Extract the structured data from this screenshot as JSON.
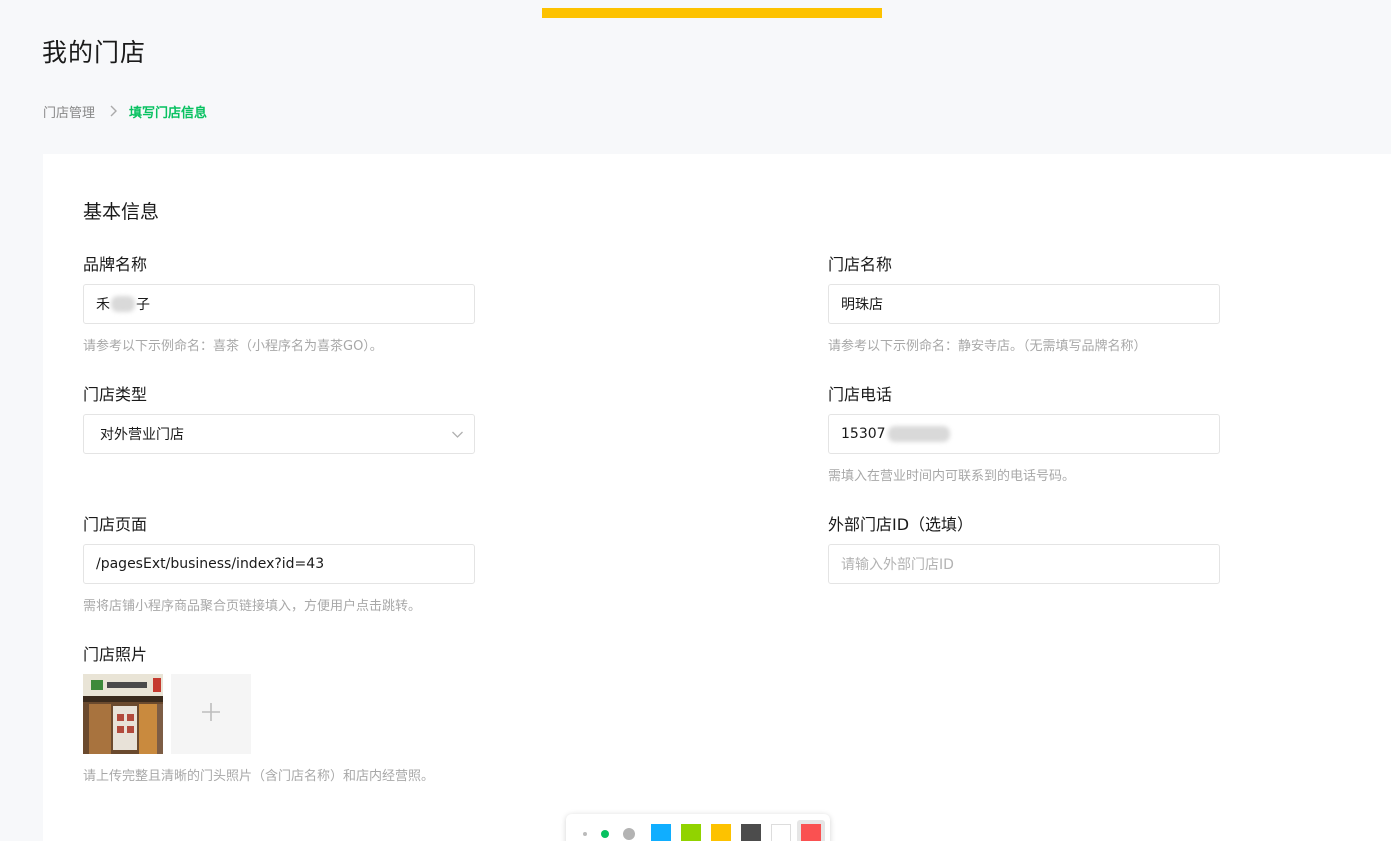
{
  "header": {
    "title": "我的门店",
    "accent_color": "#fdc200"
  },
  "breadcrumb": {
    "parent": "门店管理",
    "current": "填写门店信息",
    "current_color": "#07c160"
  },
  "form": {
    "section_title": "基本信息",
    "brand_name": {
      "label": "品牌名称",
      "value_start": "禾",
      "value_end": "子",
      "hint": "请参考以下示例命名：喜茶（小程序名为喜茶GO）。"
    },
    "store_name": {
      "label": "门店名称",
      "value": "明珠店",
      "hint": "请参考以下示例命名：静安寺店。（无需填写品牌名称）"
    },
    "store_type": {
      "label": "门店类型",
      "selected": "对外营业门店"
    },
    "store_phone": {
      "label": "门店电话",
      "value": "15307",
      "hint": "需填入在营业时间内可联系到的电话号码。"
    },
    "store_page": {
      "label": "门店页面",
      "value": "/pagesExt/business/index?id=43",
      "hint": "需将店铺小程序商品聚合页链接填入，方便用户点击跳转。"
    },
    "external_id": {
      "label": "外部门店ID（选填）",
      "placeholder": "请输入外部门店ID"
    },
    "store_photos": {
      "label": "门店照片",
      "hint": "请上传完整且清晰的门头照片（含门店名称）和店内经营照。",
      "add_icon": "plus-icon"
    }
  },
  "toolbar": {
    "sizes": [
      "small",
      "medium",
      "large"
    ],
    "size_colors": [
      "#bbbbbb",
      "#07c160",
      "#b3b3b3"
    ],
    "colors": [
      "#10aeff",
      "#91d300",
      "#fdc200",
      "#4c4c4c",
      "#ffffff",
      "#fa5151"
    ]
  }
}
